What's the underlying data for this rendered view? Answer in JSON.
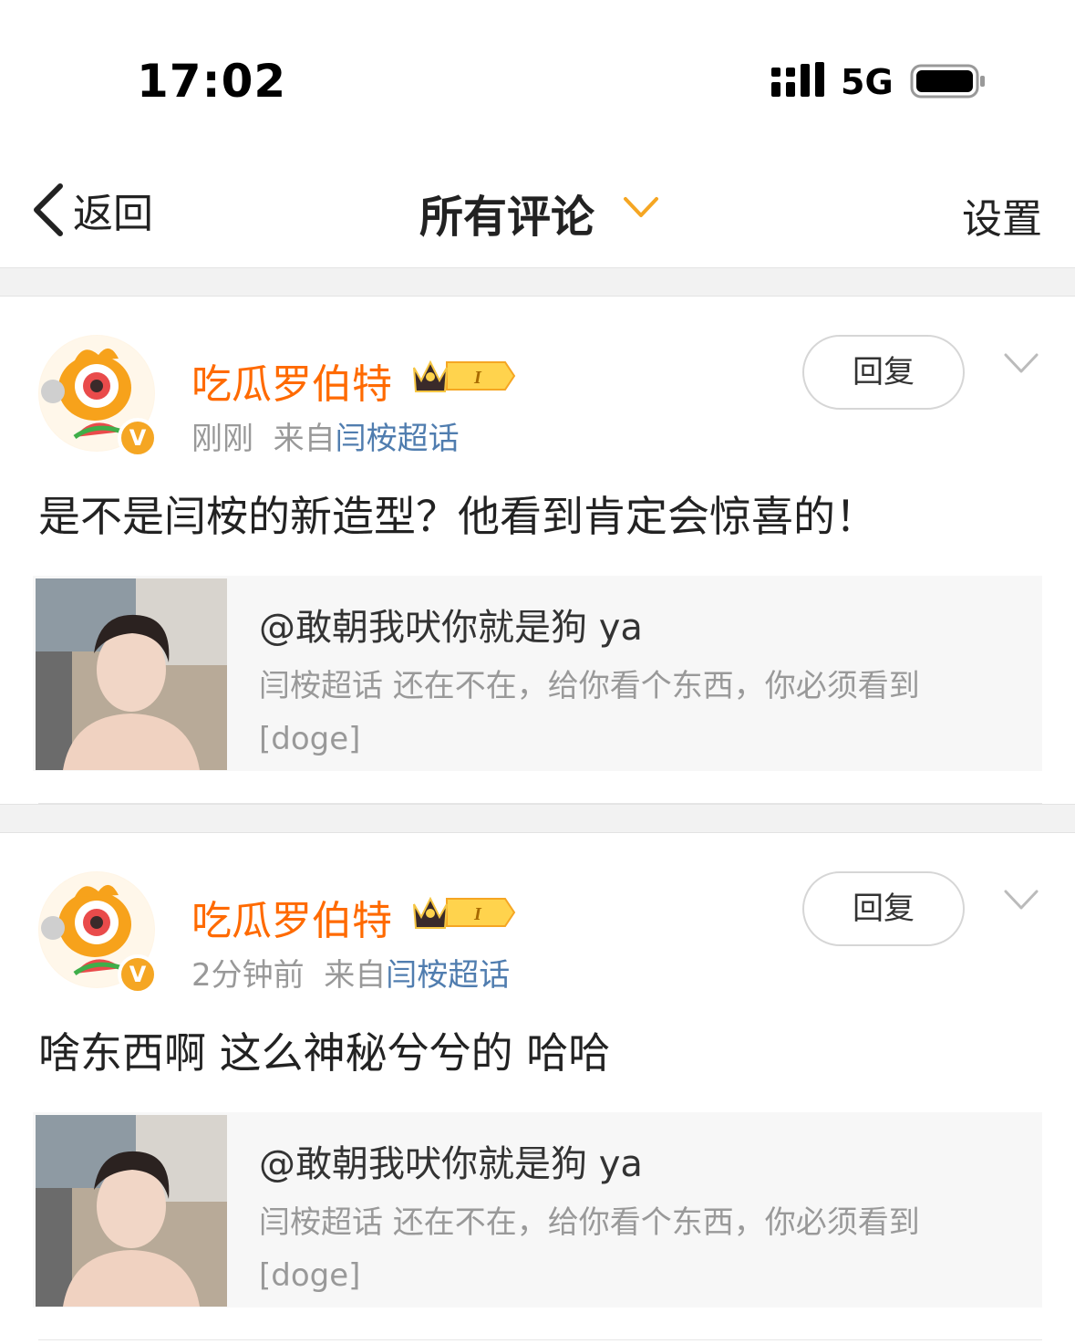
{
  "status": {
    "time": "17:02",
    "network": "5G"
  },
  "nav": {
    "back_label": "返回",
    "title": "所有评论",
    "settings_label": "设置"
  },
  "comments": [
    {
      "username": "吃瓜罗伯特",
      "rank": "I",
      "time": "刚刚",
      "source_prefix": "来自",
      "source": "闫桉超话",
      "reply_label": "回复",
      "text": "是不是闫桉的新造型？他看到肯定会惊喜的！",
      "quote": {
        "user": "@敢朝我吠你就是狗 ya",
        "topic": "闫桉超话",
        "body": "还在不在，给你看个东西，你必须看到",
        "emoji": "[doge]"
      }
    },
    {
      "username": "吃瓜罗伯特",
      "rank": "I",
      "time": "2分钟前",
      "source_prefix": "来自",
      "source": "闫桉超话",
      "reply_label": "回复",
      "text": "啥东西啊 这么神秘兮兮的 哈哈",
      "quote": {
        "user": "@敢朝我吠你就是狗 ya",
        "topic": "闫桉超话",
        "body": "还在不在，给你看个东西，你必须看到",
        "emoji": "[doge]"
      }
    }
  ],
  "colors": {
    "username": "#ff6a00",
    "link": "#507daf",
    "muted": "#999999",
    "accent": "#f5a623"
  }
}
